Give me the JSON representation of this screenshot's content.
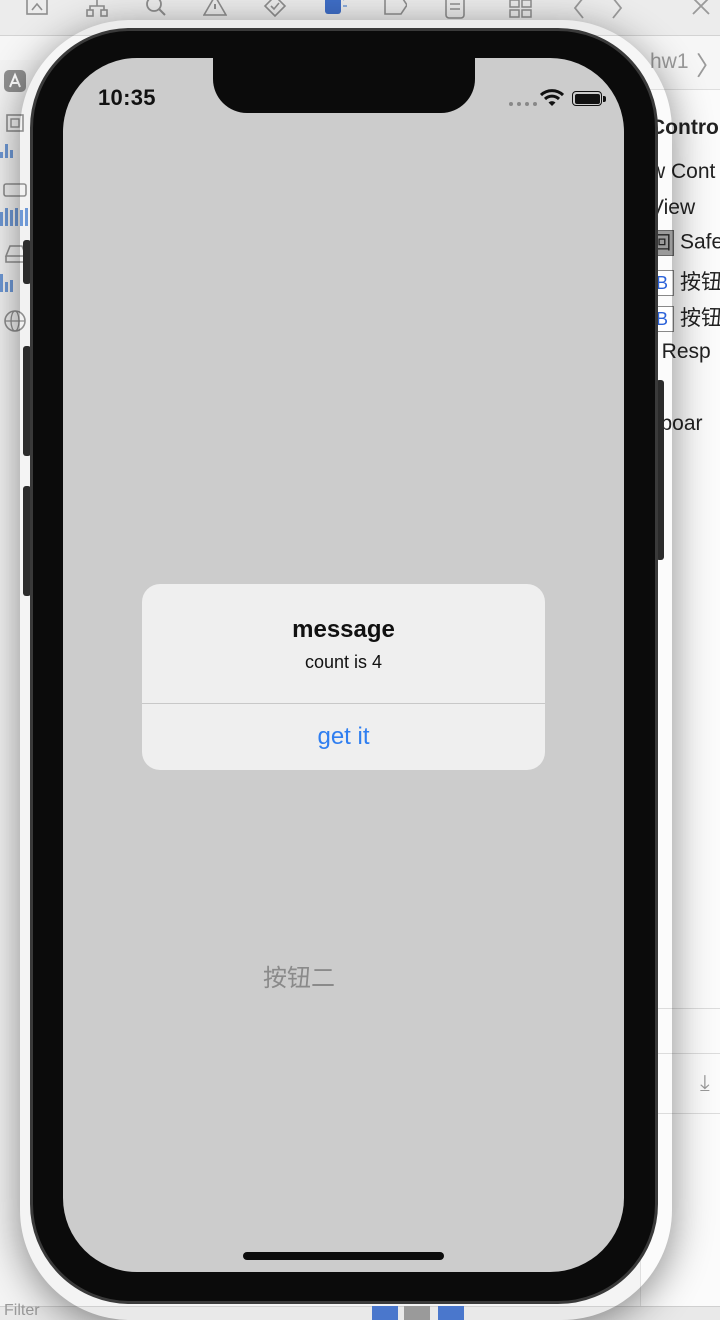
{
  "xcode": {
    "jump_bar": {
      "target": "hw1"
    },
    "outline": {
      "items": [
        "Control",
        "w Cont",
        "View",
        "Safe",
        "按钮",
        "按钮",
        "t Resp",
        "yboar"
      ],
      "badges": [
        "回",
        "B",
        "B"
      ]
    },
    "footer": {
      "filter_label": "Filter"
    }
  },
  "simulator": {
    "status_bar": {
      "time": "10:35"
    },
    "screen": {
      "button_two_label": "按钮二",
      "background_color": "#cccccc"
    },
    "alert": {
      "title": "message",
      "message": "count is 4",
      "action_label": "get it",
      "action_color": "#2f7ef0"
    }
  }
}
